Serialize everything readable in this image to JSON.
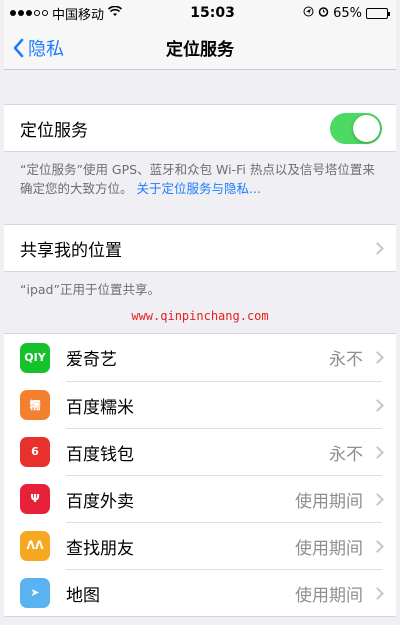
{
  "status_bar": {
    "carrier": "中国移动",
    "time": "15:03",
    "battery": "65%"
  },
  "nav": {
    "back_label": "隐私",
    "title": "定位服务"
  },
  "location_services": {
    "label": "定位服务",
    "enabled": true,
    "toggle_color": "#4cd964",
    "note": "“定位服务”使用 GPS、蓝牙和众包 Wi-Fi 热点以及信号塔位置来确定您的大致方位。",
    "note_link": "关于定位服务与隐私..."
  },
  "share_location": {
    "label": "共享我的位置",
    "note": "“ipad”正用于位置共享。"
  },
  "watermark": "www.qinpinchang.com",
  "apps": [
    {
      "name": "爱奇艺",
      "value": "永不",
      "icon": "iqiyi-icon",
      "color": "#17c12c",
      "glyph": "QIY"
    },
    {
      "name": "百度糯米",
      "value": "",
      "icon": "baidu-nuomi-icon",
      "color": "#f2802f",
      "glyph": "糯"
    },
    {
      "name": "百度钱包",
      "value": "永不",
      "icon": "baidu-wallet-icon",
      "color": "#e8312d",
      "glyph": "6"
    },
    {
      "name": "百度外卖",
      "value": "使用期间",
      "icon": "baidu-waimai-icon",
      "color": "#e8213a",
      "glyph": "Ψ"
    },
    {
      "name": "查找朋友",
      "value": "使用期间",
      "icon": "find-friends-icon",
      "color": "#f7a823",
      "glyph": "ᐱᐱ"
    },
    {
      "name": "地图",
      "value": "使用期间",
      "icon": "maps-icon",
      "color": "#5ab2f0",
      "glyph": "➤"
    }
  ]
}
